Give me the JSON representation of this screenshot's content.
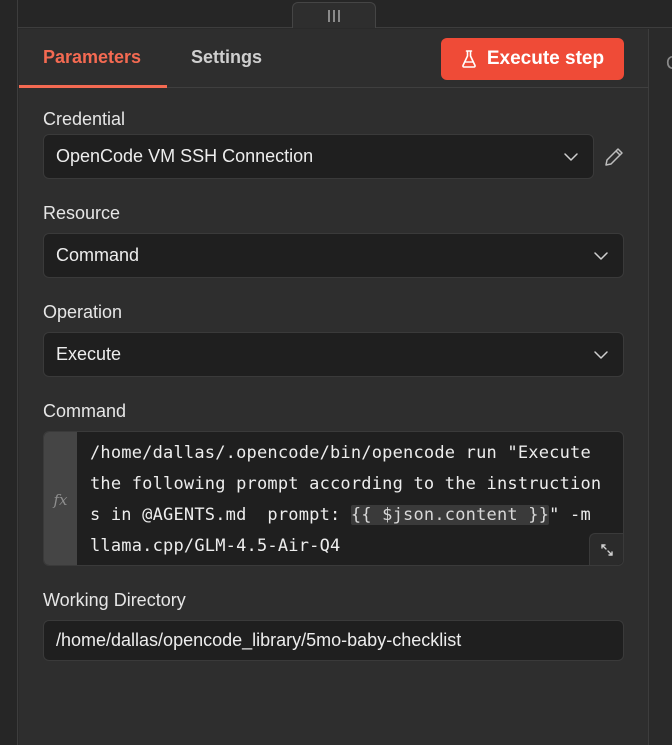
{
  "tabs": {
    "parameters": "Parameters",
    "settings": "Settings"
  },
  "execute_button": {
    "label": "Execute step",
    "icon": "flask-icon",
    "color": "#ef4b37"
  },
  "credential": {
    "label": "Credential",
    "value": "OpenCode VM SSH Connection"
  },
  "resource": {
    "label": "Resource",
    "value": "Command"
  },
  "operation": {
    "label": "Operation",
    "value": "Execute"
  },
  "command": {
    "label": "Command",
    "fx": "fx",
    "line1": "/home/dallas/.opencode/bin/opencode run \"Execute",
    "line2": "the following prompt according to the instruction",
    "line3_pre": "s in @AGENTS.md  prompt: ",
    "line3_expr": "{{ $json.content }}",
    "line3_post": "\" -m",
    "line4": "llama.cpp/GLM-4.5-Air-Q4"
  },
  "working_directory": {
    "label": "Working Directory",
    "value": "/home/dallas/opencode_library/5mo-baby-checklist"
  },
  "right_edge_glyph": "C",
  "accent_color": "#f46a52"
}
